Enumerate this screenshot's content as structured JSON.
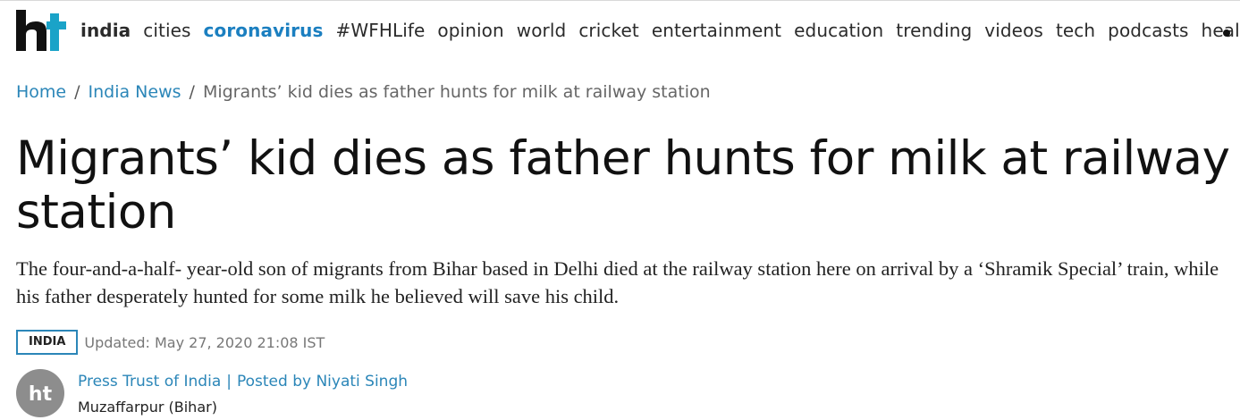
{
  "header": {
    "logo_text": "ht",
    "nav_items": [
      {
        "label": "india",
        "state": "active"
      },
      {
        "label": "cities",
        "state": ""
      },
      {
        "label": "coronavirus",
        "state": "highlight"
      },
      {
        "label": "#WFHLife",
        "state": ""
      },
      {
        "label": "opinion",
        "state": ""
      },
      {
        "label": "world",
        "state": ""
      },
      {
        "label": "cricket",
        "state": ""
      },
      {
        "label": "entertainment",
        "state": ""
      },
      {
        "label": "education",
        "state": ""
      },
      {
        "label": "trending",
        "state": ""
      },
      {
        "label": "videos",
        "state": ""
      },
      {
        "label": "tech",
        "state": ""
      },
      {
        "label": "podcasts",
        "state": ""
      },
      {
        "label": "health",
        "state": ""
      }
    ],
    "more_icon": "more-dot-icon"
  },
  "breadcrumb": {
    "home": "Home",
    "separator": "/",
    "section": "India News",
    "current": "Migrants’ kid dies as father hunts for milk at railway station"
  },
  "article": {
    "headline": "Migrants’ kid dies as father hunts for milk at railway station",
    "summary": "The four-and-a-half- year-old son of migrants from Bihar based in Delhi died at the railway station here on arrival by a ‘Shramik Special’ train, while his father desperately hunted for some milk he believed will save his child.",
    "section_tag": "INDIA",
    "updated": "Updated: May 27, 2020 21:08 IST",
    "byline": {
      "agency": "Press Trust of India",
      "separator": "|",
      "posted_by": "Posted by Niyati Singh",
      "avatar_text": "ht"
    },
    "location": "Muzaffarpur (Bihar)"
  },
  "colors": {
    "accent_blue": "#2b86b8",
    "highlight_blue": "#1b7fc0",
    "logo_teal": "#1aa3c8",
    "logo_black": "#111111",
    "avatar_gray": "#8d8d8d"
  }
}
